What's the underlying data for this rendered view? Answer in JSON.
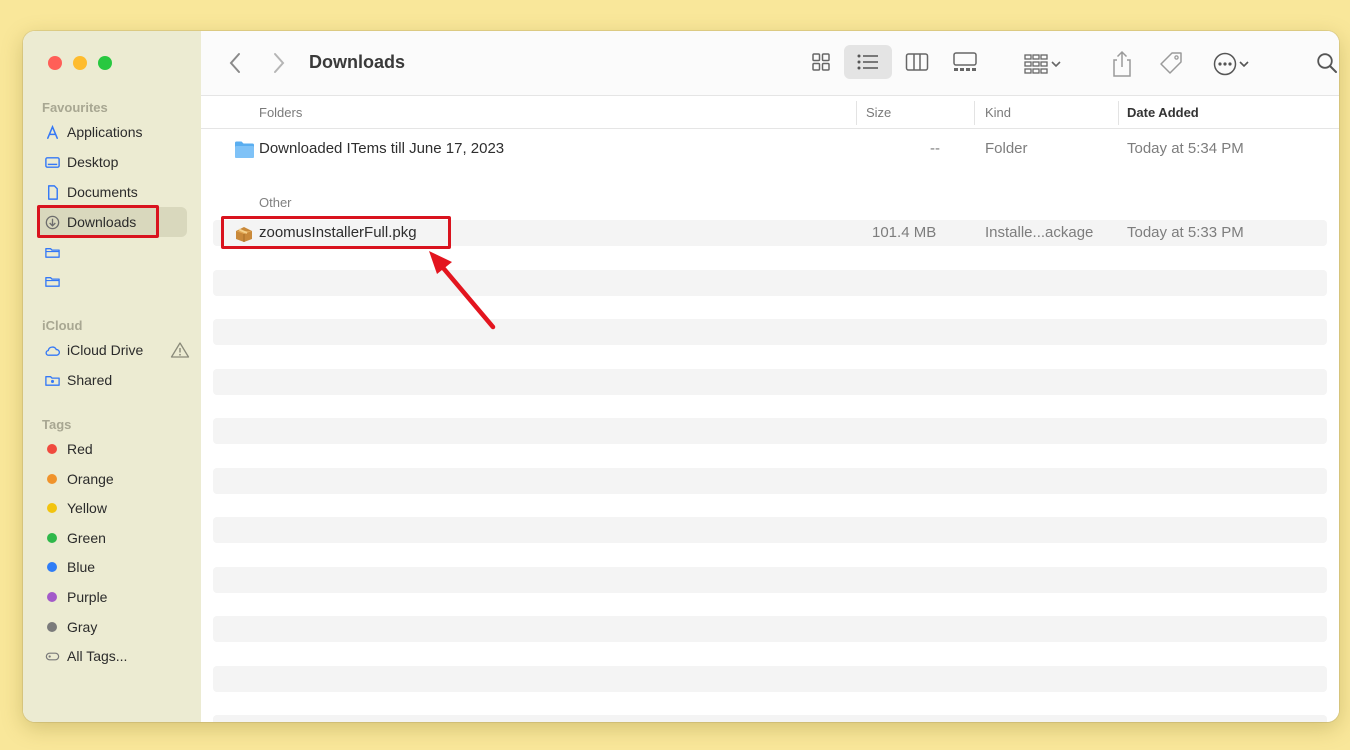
{
  "window": {
    "title": "Downloads"
  },
  "sidebar": {
    "favourites_label": "Favourites",
    "favourites": [
      {
        "label": "Applications",
        "icon": "applications-icon"
      },
      {
        "label": "Desktop",
        "icon": "desktop-icon"
      },
      {
        "label": "Documents",
        "icon": "document-icon"
      },
      {
        "label": "Downloads",
        "icon": "download-icon",
        "selected": true
      },
      {
        "label": "",
        "icon": "folder-icon"
      },
      {
        "label": "",
        "icon": "folder-icon"
      }
    ],
    "icloud_label": "iCloud",
    "icloud": [
      {
        "label": "iCloud Drive",
        "icon": "cloud-icon"
      },
      {
        "label": "Shared",
        "icon": "shared-folder-icon"
      }
    ],
    "tags_label": "Tags",
    "tags": [
      {
        "label": "Red",
        "color": "#f04a3e"
      },
      {
        "label": "Orange",
        "color": "#f0932b"
      },
      {
        "label": "Yellow",
        "color": "#f2c40f"
      },
      {
        "label": "Green",
        "color": "#2fb84a"
      },
      {
        "label": "Blue",
        "color": "#2f7df6"
      },
      {
        "label": "Purple",
        "color": "#a35ac9"
      },
      {
        "label": "Gray",
        "color": "#7b7b7b"
      },
      {
        "label": "All Tags...",
        "icon": "all-tags-icon"
      }
    ]
  },
  "columns": {
    "name": "Folders",
    "size": "Size",
    "kind": "Kind",
    "date": "Date Added"
  },
  "files": {
    "folder_row": {
      "name": "Downloaded ITems till June 17, 2023",
      "size": "--",
      "kind": "Folder",
      "date": "Today at 5:34 PM"
    },
    "other_label": "Other",
    "pkg_row": {
      "name": "zoomusInstallerFull.pkg",
      "size": "101.4 MB",
      "kind": "Installe...ackage",
      "date": "Today at 5:33 PM"
    }
  },
  "colors": {
    "accent_highlight": "#d9131e",
    "background": "#f9e79a",
    "sidebar": "#ecebd2"
  }
}
